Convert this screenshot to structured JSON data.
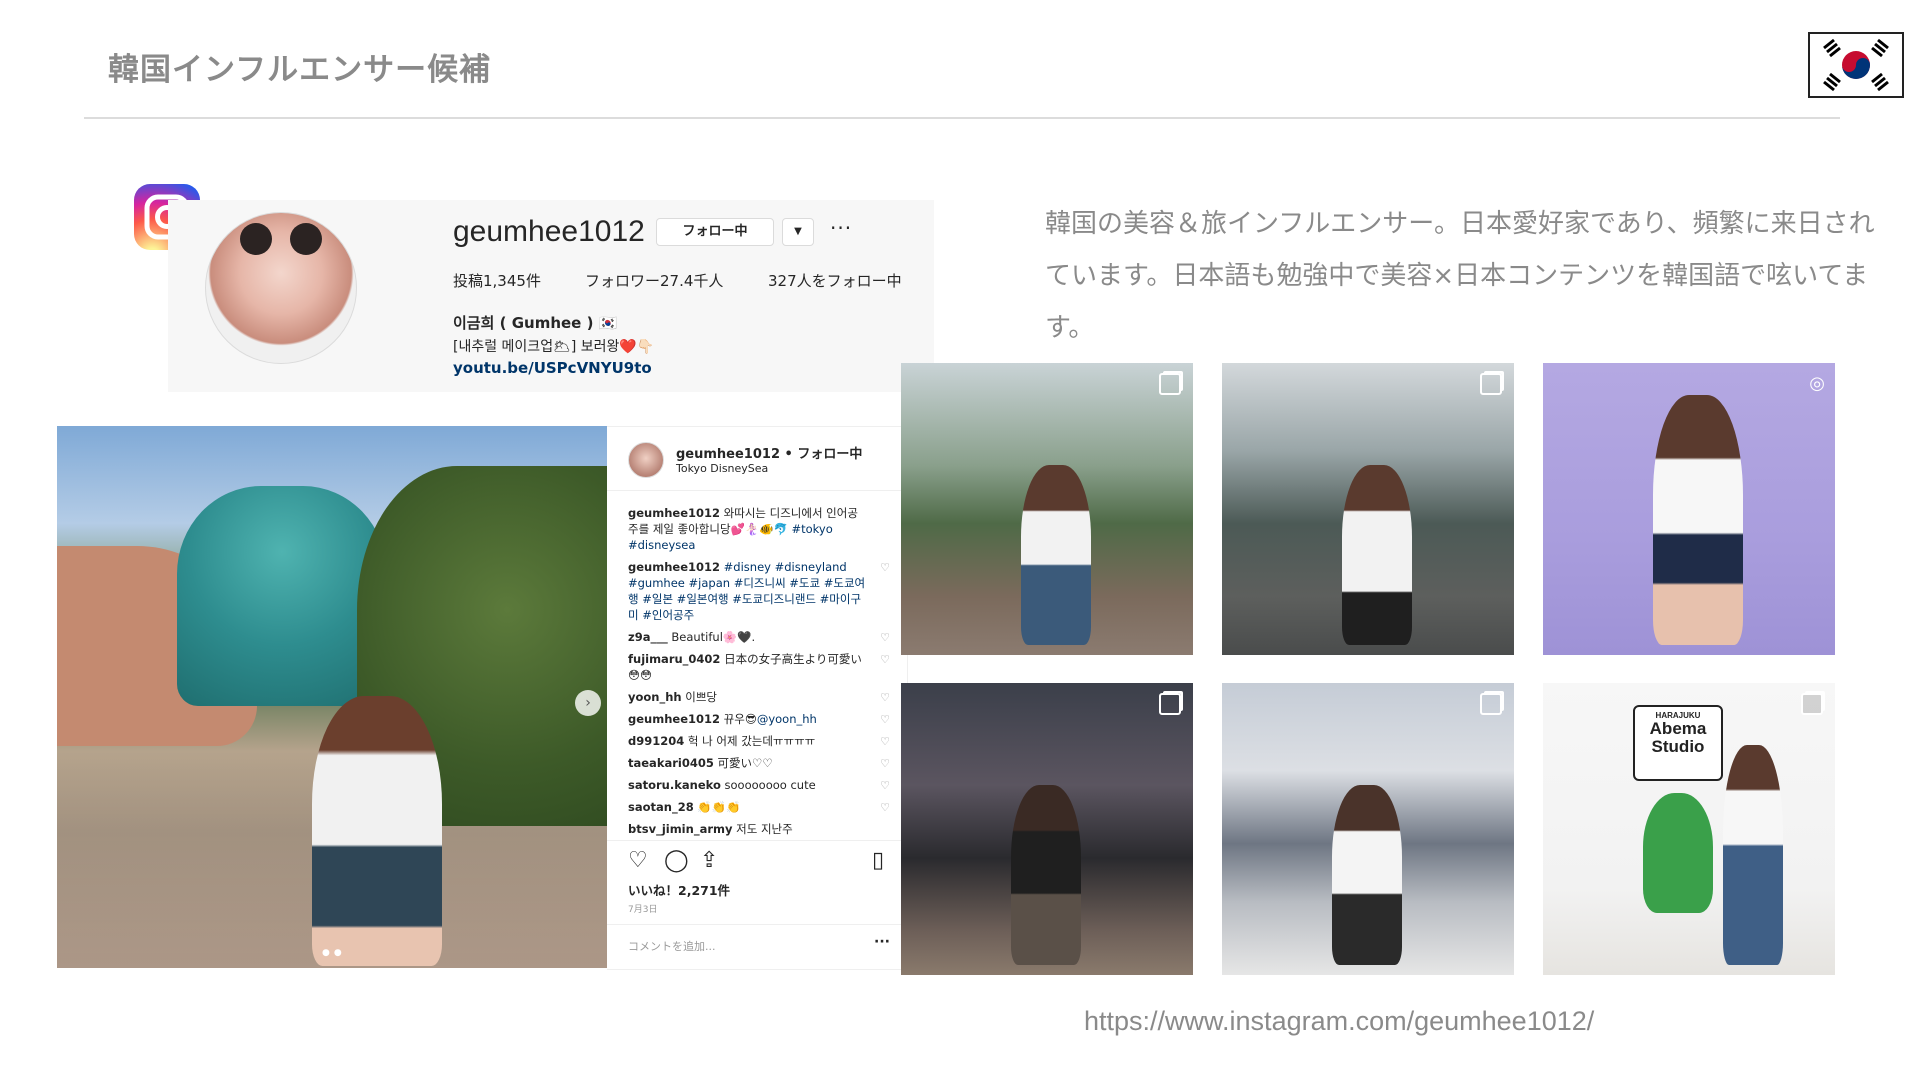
{
  "slide": {
    "title": "韓国インフルエンサー候補",
    "flag_icon": "south-korea-flag-icon"
  },
  "profile": {
    "username": "geumhee1012",
    "follow_label": "フォロー中",
    "caret": "▼",
    "more": "···",
    "posts": "投稿1,345件",
    "followers": "フォロワー27.4千人",
    "following": "327人をフォロー中",
    "bio_name": "이금희 ( Gumhee ) 🇰🇷",
    "bio_line": "[내추럴 메이크업🌥] 보러왕❤️👇🏻",
    "bio_link": "youtu.be/USPcVNYU9to"
  },
  "post": {
    "header_user": "geumhee1012 • フォロー中",
    "location": "Tokyo DisneySea",
    "comments": [
      {
        "user": "geumhee1012",
        "text": " 와따시는 디즈니에서 인어공주를 제일 좋아합니당💕🧜🏻‍♀️🐠🐬 ",
        "tags": "#tokyo #disneysea",
        "heart": ""
      },
      {
        "user": "geumhee1012",
        "text": " ",
        "tags": "#disney #disneyland #gumhee #japan #디즈니씨 #도쿄 #도쿄여행 #일본 #일본여행 #도쿄디즈니랜드 #마이구미 #인어공주",
        "heart": "♡"
      },
      {
        "user": "z9a___",
        "text": " Beautiful🌸🖤.",
        "tags": "",
        "heart": "♡"
      },
      {
        "user": "fujimaru_0402",
        "text": " 日本の女子高生より可愛い😳😳",
        "tags": "",
        "heart": "♡"
      },
      {
        "user": "yoon_hh",
        "text": " 이쁘당",
        "tags": "",
        "heart": "♡"
      },
      {
        "user": "geumhee1012",
        "text": " 뀨우😎",
        "tags": "@yoon_hh",
        "heart": "♡"
      },
      {
        "user": "d991204",
        "text": " 헉 나 어제 갔는데ㅠㅠㅠㅠ",
        "tags": "",
        "heart": "♡"
      },
      {
        "user": "taeakari0405",
        "text": " 可愛い♡♡",
        "tags": "",
        "heart": "♡"
      },
      {
        "user": "satoru.kaneko",
        "text": " soooooooo cute",
        "tags": "",
        "heart": "♡"
      },
      {
        "user": "saotan_28",
        "text": " 👏👏👏",
        "tags": "",
        "heart": "♡"
      },
      {
        "user": "btsv_jimin_army",
        "text": " 저도 지난주",
        "tags": "",
        "heart": ""
      }
    ],
    "icons": {
      "like": "♡",
      "comment": "◯",
      "share": "⇪",
      "save": "▯"
    },
    "likes": "いいね！2,271件",
    "date": "7月3日",
    "add_comment_placeholder": "コメントを追加...",
    "add_more": "···",
    "nav_arrow": "›",
    "dots": "●●"
  },
  "description": "韓国の美容＆旅インフルエンサー。日本愛好家であり、頻繁に来日されています。日本語も勉強中で美容×日本コンテンツを韓国語で呟いてます。",
  "grid": {
    "tile6_sign_top": "HARAJUKU",
    "tile6_sign_main": "Abema Studio"
  },
  "url": "https://www.instagram.com/geumhee1012/"
}
